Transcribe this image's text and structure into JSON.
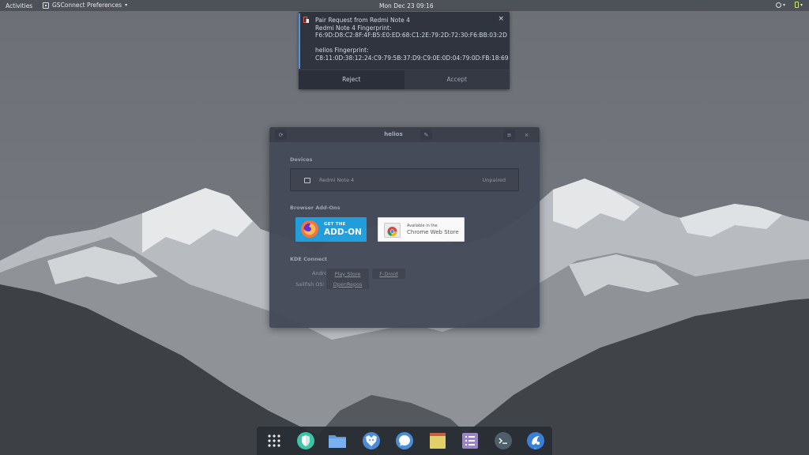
{
  "topbar": {
    "activities": "Activities",
    "app_menu_label": "GSConnect Preferences",
    "app_menu_caret": "▾",
    "clock": "Mon Dec 23  09:16",
    "tray_caret": "▾"
  },
  "notification": {
    "title": "Pair Request from Redmi Note 4",
    "line1_label": "Redmi Note 4 Fingerprint:",
    "line1_value": "F6:9D:D8:C2:8F:4F:B5:E0:ED:68:C1:2E:79:2D:72:30:F6:BB:03:2D",
    "line2_label": "helios Fingerprint:",
    "line2_value": "C8:11:0D:38:12:24:C9:79:5B:37:D9:C9:0E:0D:04:79:0D:FB:18:69",
    "close": "×",
    "reject": "Reject",
    "accept": "Accept",
    "accent_color": "#5294e2"
  },
  "window": {
    "title": "helios",
    "menu_glyph": "≡",
    "close_glyph": "×",
    "refresh_glyph": "⟳",
    "edit_glyph": "✎",
    "devices_label": "Devices",
    "device": {
      "name": "Redmi Note 4",
      "status": "Unpaired"
    },
    "browser_addons_label": "Browser Add-Ons",
    "firefox_badge": {
      "line1": "GET THE",
      "line2": "ADD-ON"
    },
    "chrome_badge": {
      "line1": "Available in the",
      "line2": "Chrome Web Store"
    },
    "kde_label": "KDE Connect",
    "android_label": "Android:",
    "sailfish_label": "Sailfish OS:",
    "play_store": "Play Store",
    "fdroid": "F-Droid",
    "openrepos": "OpenRepos"
  },
  "dock": {
    "items": [
      "apps-grid-icon",
      "shield-icon",
      "files-icon",
      "firefox-icon",
      "signal-icon",
      "notes-icon",
      "tasks-icon",
      "terminal-icon",
      "gsconnect-icon"
    ]
  }
}
